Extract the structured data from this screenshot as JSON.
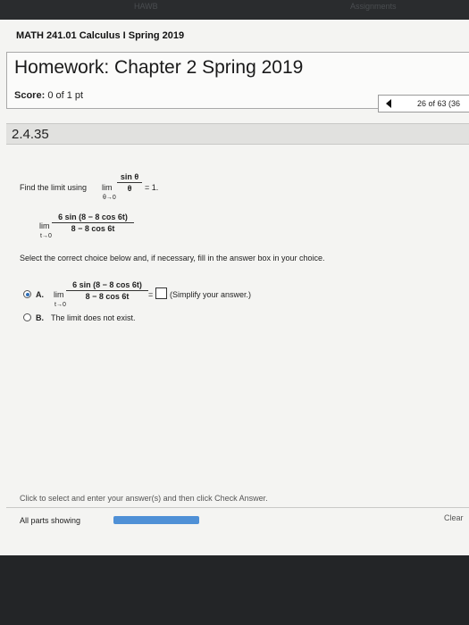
{
  "window": {
    "top_left_ghost": "HAWB",
    "top_right_ghost": "Assignments"
  },
  "course": {
    "title": "MATH 241.01 Calculus I Spring 2019"
  },
  "homework": {
    "title": "Homework: Chapter 2 Spring 2019",
    "score_label": "Score:",
    "score_value": "0 of 1 pt"
  },
  "navigation": {
    "position": "26 of 63 (36"
  },
  "question": {
    "number": "2.4.35",
    "prompt_prefix": "Find the limit using",
    "hint": {
      "lim": "lim",
      "sub": "θ→0",
      "num": "sin θ",
      "den": "θ",
      "tail": "= 1."
    },
    "expr": {
      "lim": "lim",
      "sub": "t→0",
      "num": "6 sin (8 − 8 cos 6t)",
      "den": "8 − 8 cos 6t"
    },
    "instruction": "Select the correct choice below and, if necessary, fill in the answer box in your choice.",
    "choices": [
      {
        "letter": "A.",
        "selected": true,
        "lim": "lim",
        "sub": "t→0",
        "num": "6 sin (8 − 8 cos 6t)",
        "den": "8 − 8 cos 6t",
        "eq": "=",
        "note": "(Simplify your answer.)"
      },
      {
        "letter": "B.",
        "selected": false,
        "text": "The limit does not exist."
      }
    ]
  },
  "footer": {
    "instruction": "Click to select and enter your answer(s) and then click Check Answer.",
    "parts_label": "All parts showing",
    "progress_fraction": 1.0,
    "clear_label": "Clear"
  },
  "colors": {
    "accent": "#2f6fb8",
    "progress": "#4f90d6"
  }
}
